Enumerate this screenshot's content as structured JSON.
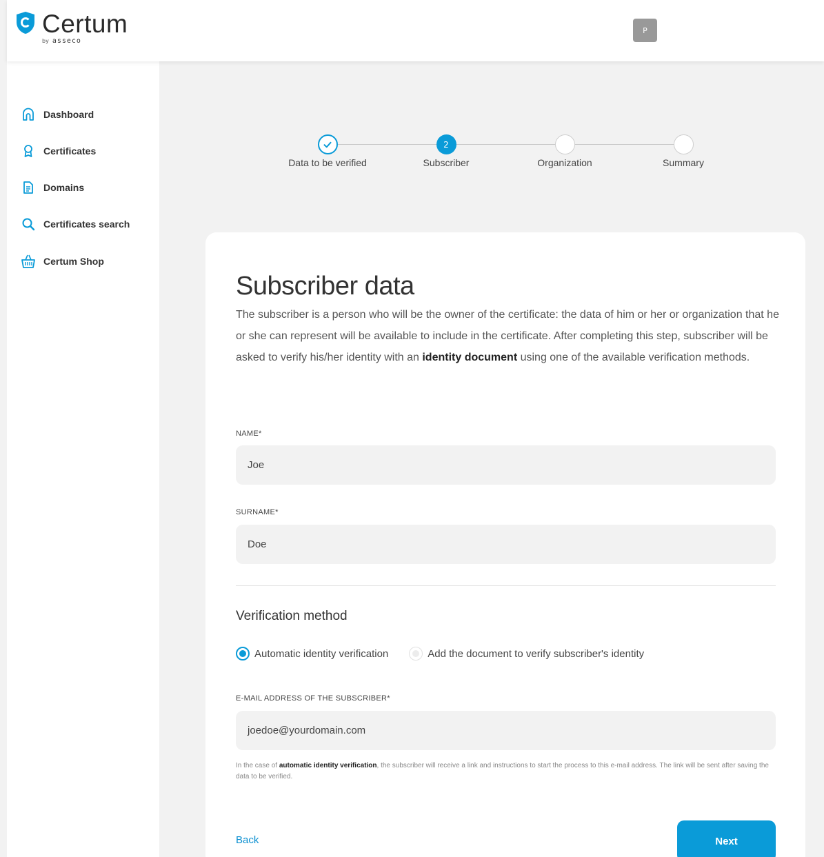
{
  "header": {
    "brand": "Certum",
    "brand_by": "by",
    "brand_sub": "asseco",
    "avatar_initial": "P"
  },
  "sidebar": {
    "items": [
      {
        "label": "Dashboard",
        "icon": "home-icon"
      },
      {
        "label": "Certificates",
        "icon": "award-icon"
      },
      {
        "label": "Domains",
        "icon": "document-icon"
      },
      {
        "label": "Certificates search",
        "icon": "search-icon"
      },
      {
        "label": "Certum Shop",
        "icon": "basket-icon"
      }
    ]
  },
  "stepper": {
    "steps": [
      {
        "label": "Data to be verified",
        "state": "done",
        "number": ""
      },
      {
        "label": "Subscriber",
        "state": "active",
        "number": "2"
      },
      {
        "label": "Organization",
        "state": "pending",
        "number": ""
      },
      {
        "label": "Summary",
        "state": "pending",
        "number": ""
      }
    ]
  },
  "form": {
    "title": "Subscriber data",
    "intro_part1": "The subscriber is a person who will be the owner of the certificate: the data of him or her or organization that he or she can represent will be available to include in the certificate. After completing this step, subscriber will be asked to verify his/her identity with an ",
    "intro_bold": "identity document",
    "intro_part2": " using one of the available verification methods.",
    "name_label": "NAME*",
    "name_value": "Joe",
    "surname_label": "SURNAME*",
    "surname_value": "Doe",
    "verification_title": "Verification method",
    "radio_options": [
      {
        "label": "Automatic identity verification",
        "selected": true
      },
      {
        "label": "Add the document to verify subscriber's identity",
        "selected": false
      }
    ],
    "email_label": "E-MAIL ADDRESS OF THE SUBSCRIBER*",
    "email_value": "joedoe@yourdomain.com",
    "note_part1": "In the case of ",
    "note_bold": "automatic identity verification",
    "note_part2": ", the subscriber will receive a link and instructions to start the process to this e-mail address. The link will be sent after saving the data to be verified.",
    "back_label": "Back",
    "next_label": "Next"
  },
  "colors": {
    "accent": "#0a9bd8",
    "page_bg": "#f2f2f2",
    "input_bg": "#f2f2f2"
  }
}
